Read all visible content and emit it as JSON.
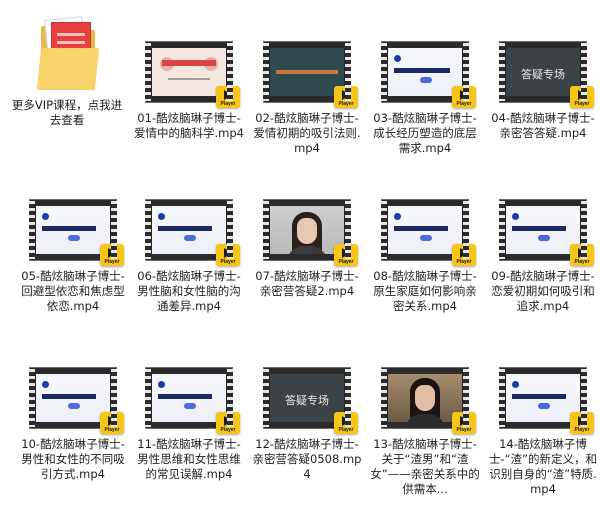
{
  "player_badge": "Player",
  "folder": {
    "label": "更多VIP课程，点我进去查看"
  },
  "videos": [
    {
      "label": "01-酷炫脑琳子博士-爱情中的脑科学.mp4",
      "thumb": "red",
      "slide_title": ""
    },
    {
      "label": "02-酷炫脑琳子博士-爱情初期的吸引法则.mp4",
      "thumb": "teal",
      "slide_title": ""
    },
    {
      "label": "03-酷炫脑琳子博士-成长经历塑造的底层需求.mp4",
      "thumb": "white",
      "slide_title": ""
    },
    {
      "label": "04-酷炫脑琳子博士-亲密答答疑.mp4",
      "thumb": "dark",
      "slide_title": "答疑专场"
    },
    {
      "label": "05-酷炫脑琳子博士-回避型依恋和焦虑型依恋.mp4",
      "thumb": "white",
      "slide_title": ""
    },
    {
      "label": "06-酷炫脑琳子博士-男性脑和女性脑的沟通差异.mp4",
      "thumb": "white",
      "slide_title": ""
    },
    {
      "label": "07-酷炫脑琳子博士-亲密营答疑2.mp4",
      "thumb": "photo",
      "slide_title": ""
    },
    {
      "label": "08-酷炫脑琳子博士-原生家庭如何影响亲密关系.mp4",
      "thumb": "white",
      "slide_title": ""
    },
    {
      "label": "09-酷炫脑琳子博士-恋爱初期如何吸引和追求.mp4",
      "thumb": "white",
      "slide_title": ""
    },
    {
      "label": "10-酷炫脑琳子博士-男性和女性的不同吸引方式.mp4",
      "thumb": "white",
      "slide_title": ""
    },
    {
      "label": "11-酷炫脑琳子博士-男性思维和女性思维的常见误解.mp4",
      "thumb": "white",
      "slide_title": ""
    },
    {
      "label": "12-酷炫脑琳子博士-亲密营答疑0508.mp4",
      "thumb": "dark",
      "slide_title": "答疑专场"
    },
    {
      "label": "13-酷炫脑琳子博士-关于“渣男”和“渣女”——亲密关系中的供需本...",
      "thumb": "photo2",
      "slide_title": ""
    },
    {
      "label": "14-酷炫脑琳子博士-“渣”的新定义，和识别自身的“渣”特质.mp4",
      "thumb": "white",
      "slide_title": ""
    }
  ]
}
